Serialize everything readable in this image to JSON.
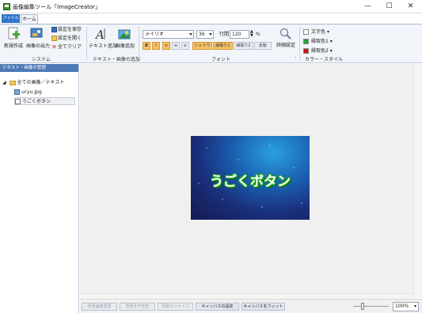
{
  "window": {
    "title": "画像編集ツール「ImageCreator」",
    "minimize": "—",
    "maximize": "☐",
    "close": "✕"
  },
  "menu": {
    "file_tab": "ファイル",
    "home_tab": "ホーム"
  },
  "ribbon": {
    "system": {
      "label": "システム",
      "new": "新規作成",
      "export": "画像の出力",
      "save_settings": "設定を保存",
      "open_settings": "設定を開く",
      "clear_all": "全てクリア"
    },
    "add": {
      "label": "テキスト・画像の追加",
      "add_text": "テキスト追加",
      "add_image": "画像追加"
    },
    "font": {
      "label": "フォント",
      "family": "メイリオ",
      "size": "36",
      "line_spacing_label": "行間",
      "line_spacing": "120",
      "line_spacing_unit": "%",
      "bold": "B",
      "italic": "I",
      "align_left": "≡",
      "align_center": "≡",
      "align_right": "≡",
      "shadow": "シャドウ",
      "outline1": "縁取り1",
      "outline2": "縁取り2",
      "invert": "反転",
      "detail": "詳細設定"
    },
    "colors": {
      "label": "カラー・スタイル",
      "text_color_label": "文字色",
      "outline1_label": "縁取色1",
      "outline2_label": "縁取色2",
      "text_color": "#ffffff",
      "outline1_color": "#21a33a",
      "outline2_color": "#c9141d"
    }
  },
  "panel": {
    "title": "テキスト・画像の管理",
    "root": "全ての画像／テキスト",
    "items": [
      "ucyu.jpg",
      "うごくボタン"
    ]
  },
  "canvas": {
    "text": "うごくボタン"
  },
  "bottom": {
    "bg_change": "背景画像変更",
    "bg_transparent": "背景を不定形",
    "bg_resize": "背景のリサイズ",
    "canvas_settings": "キャンバスの設定",
    "fit_canvas": "キャンバスをフィット",
    "zoom": "100%"
  }
}
